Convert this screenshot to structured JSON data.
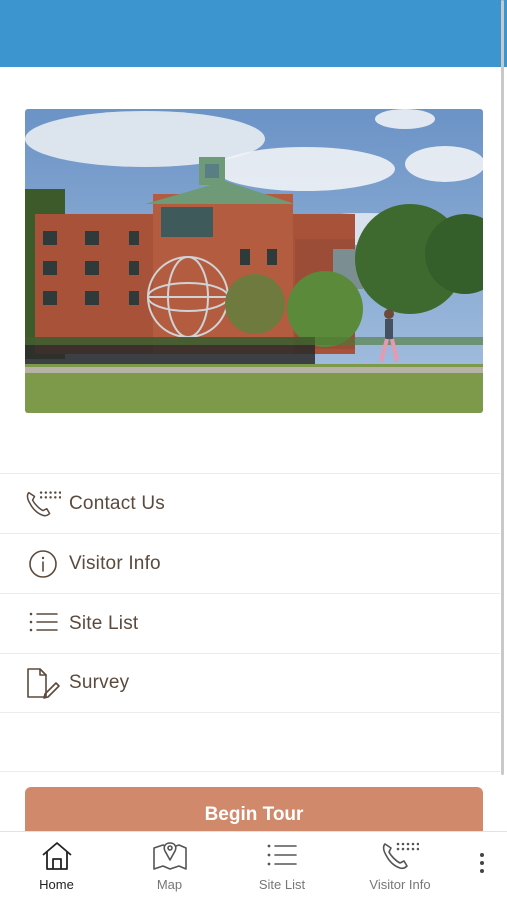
{
  "hero": {
    "image": "campus-building-globe-photo"
  },
  "menu": {
    "items": [
      {
        "label": "Contact Us",
        "icon": "phone-keypad-icon"
      },
      {
        "label": "Visitor Info",
        "icon": "info-icon"
      },
      {
        "label": "Site List",
        "icon": "list-icon"
      },
      {
        "label": "Survey",
        "icon": "survey-edit-icon"
      }
    ]
  },
  "begin_tour": {
    "label": "Begin Tour"
  },
  "bottom_nav": {
    "items": [
      {
        "label": "Home",
        "icon": "home-icon",
        "active": true
      },
      {
        "label": "Map",
        "icon": "map-pin-icon",
        "active": false
      },
      {
        "label": "Site List",
        "icon": "list-icon",
        "active": false
      },
      {
        "label": "Visitor Info",
        "icon": "phone-keypad-icon",
        "active": false
      }
    ],
    "more_icon": "more-vertical-icon"
  },
  "colors": {
    "header": "#3d95cf",
    "accent": "#d0896a",
    "text": "#5b4a3d"
  }
}
